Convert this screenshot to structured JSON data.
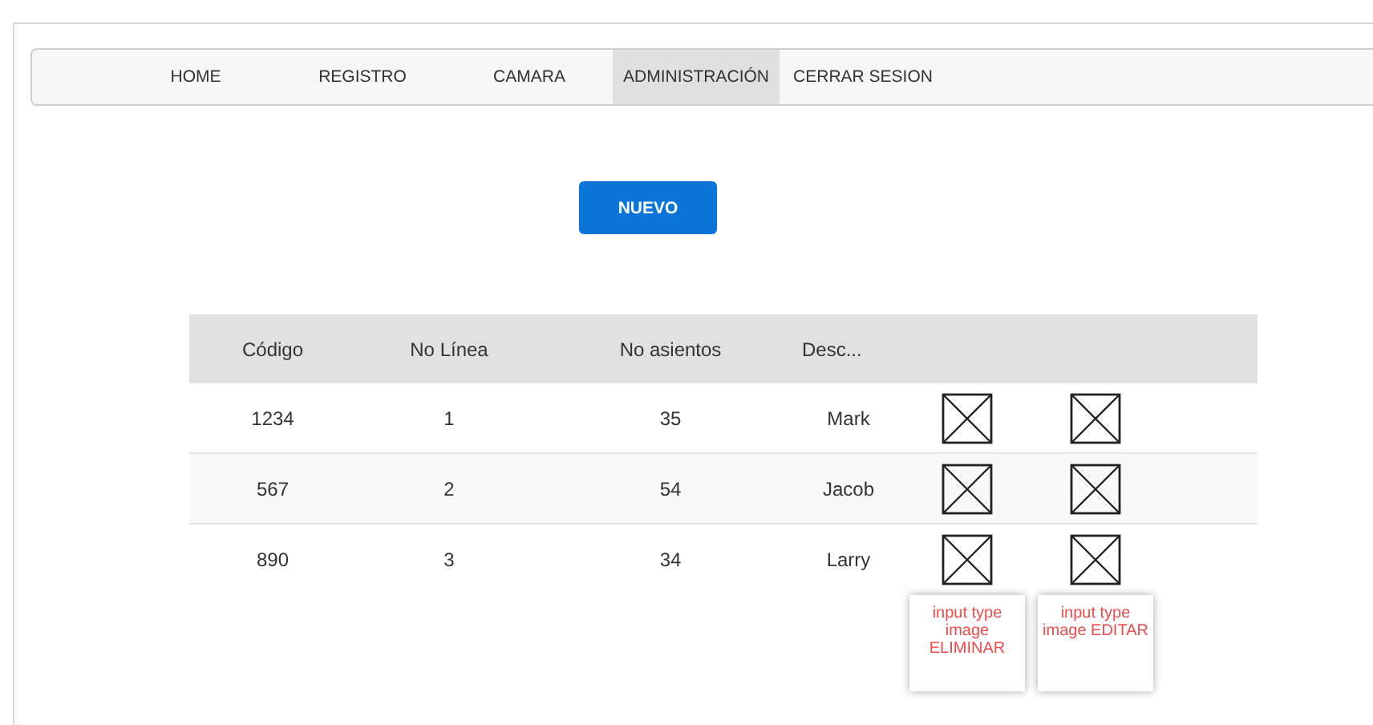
{
  "nav": [
    {
      "label": "HOME",
      "selected": false
    },
    {
      "label": "REGISTRO",
      "selected": false
    },
    {
      "label": "CAMARA",
      "selected": false
    },
    {
      "label": "ADMINISTRACIÓN",
      "selected": true
    },
    {
      "label": "CERRAR SESION",
      "selected": false
    }
  ],
  "new_button": "NUEVO",
  "table": {
    "columns": [
      "Código",
      "No Línea",
      "No asientos",
      "Desc..."
    ],
    "rows": [
      {
        "cells": [
          "1234",
          "1",
          "35",
          "Mark"
        ]
      },
      {
        "cells": [
          "567",
          "2",
          "54",
          "Jacob"
        ]
      },
      {
        "cells": [
          "890",
          "3",
          "34",
          "Larry"
        ]
      }
    ]
  },
  "callouts": [
    {
      "text": "input type image ELIMINAR"
    },
    {
      "text": "input type image EDITAR"
    }
  ]
}
